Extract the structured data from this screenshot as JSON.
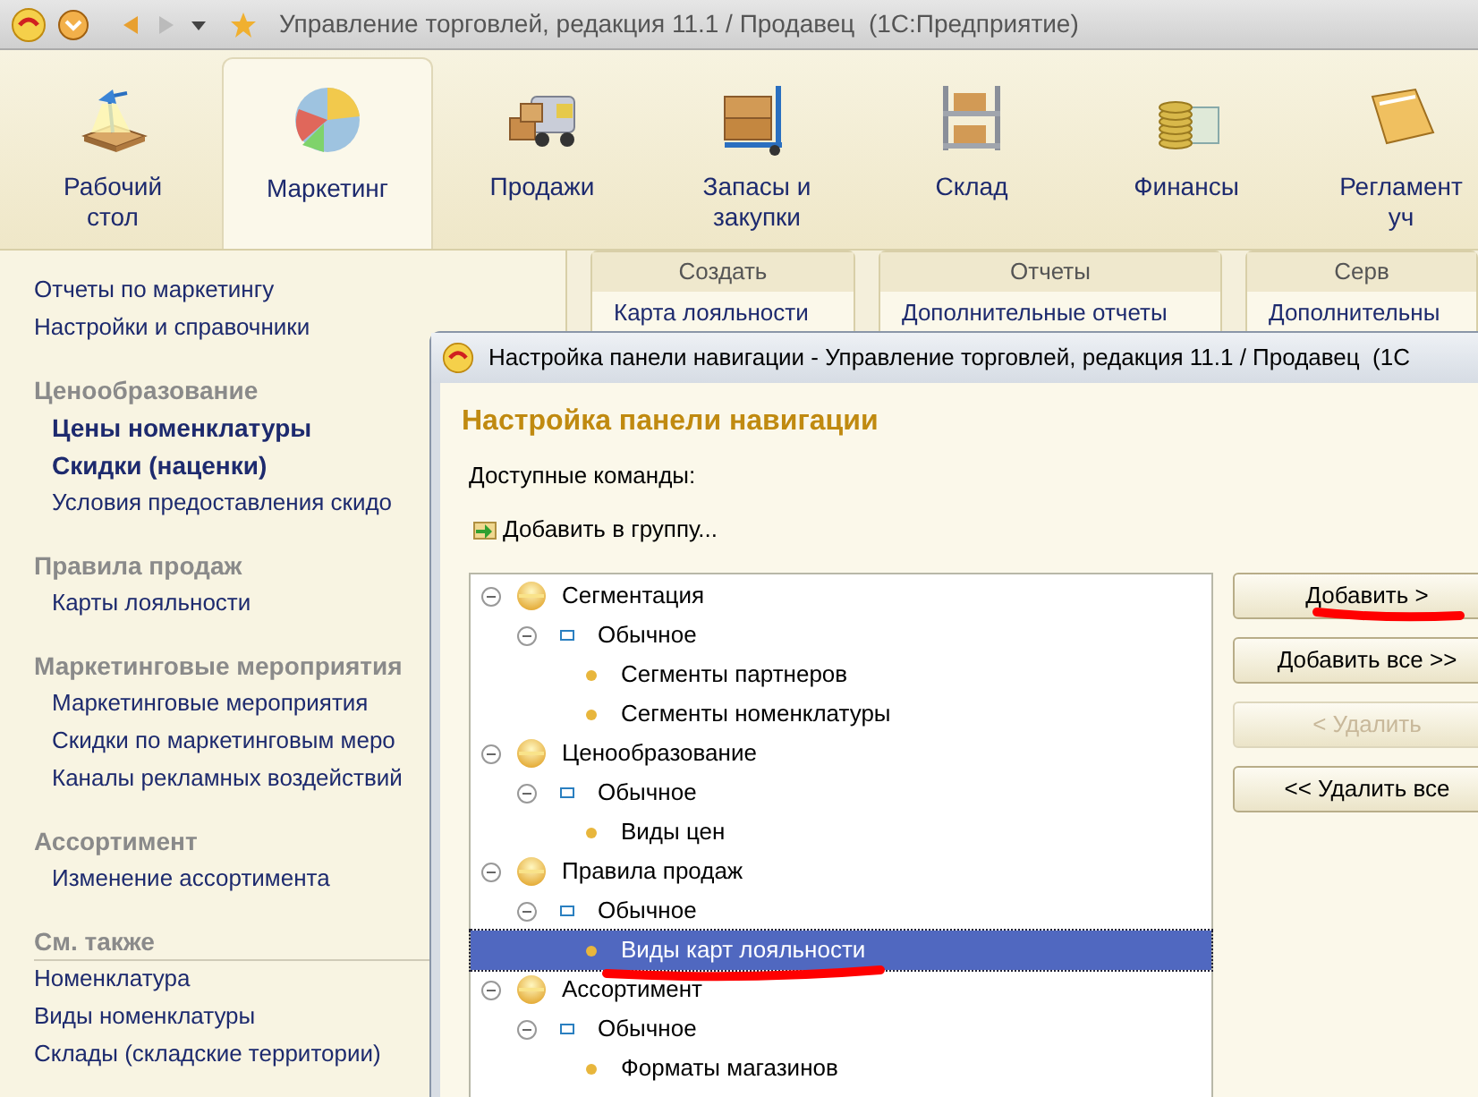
{
  "window": {
    "title": "Управление торговлей, редакция 11.1 / Продавец  (1С:Предприятие)"
  },
  "sections": [
    {
      "lines": [
        "Рабочий",
        "стол"
      ],
      "selected": false
    },
    {
      "lines": [
        "Маркетинг"
      ],
      "selected": true
    },
    {
      "lines": [
        "Продажи"
      ],
      "selected": false
    },
    {
      "lines": [
        "Запасы и",
        "закупки"
      ],
      "selected": false
    },
    {
      "lines": [
        "Склад"
      ],
      "selected": false
    },
    {
      "lines": [
        "Финансы"
      ],
      "selected": false
    },
    {
      "lines": [
        "Регламент",
        "уч"
      ],
      "selected": false
    }
  ],
  "sidebar": {
    "groups": [
      {
        "items": [
          {
            "label": "Отчеты по маркетингу",
            "emphasized": false
          },
          {
            "label": "Настройки и справочники",
            "emphasized": false
          }
        ]
      },
      {
        "title": "Ценообразование",
        "items": [
          {
            "label": "Цены номенклатуры",
            "emphasized": true
          },
          {
            "label": "Скидки (наценки)",
            "emphasized": true
          },
          {
            "label": "Условия предоставления скидо",
            "emphasized": false
          }
        ]
      },
      {
        "title": "Правила продаж",
        "items": [
          {
            "label": "Карты лояльности",
            "emphasized": false
          }
        ]
      },
      {
        "title": "Маркетинговые мероприятия",
        "items": [
          {
            "label": "Маркетинговые мероприятия",
            "emphasized": false
          },
          {
            "label": "Скидки по маркетинговым меро",
            "emphasized": false
          },
          {
            "label": "Каналы рекламных воздействий",
            "emphasized": false
          }
        ]
      },
      {
        "title": "Ассортимент",
        "items": [
          {
            "label": "Изменение ассортимента",
            "emphasized": false
          }
        ]
      },
      {
        "title": "См. также",
        "flat": true,
        "items": [
          {
            "label": "Номенклатура",
            "emphasized": false
          },
          {
            "label": "Виды номенклатуры",
            "emphasized": false
          },
          {
            "label": "Склады (складские территории)",
            "emphasized": false
          }
        ]
      }
    ]
  },
  "panels": [
    {
      "title": "Создать",
      "items": [
        "Карта лояльности"
      ]
    },
    {
      "title": "Отчеты",
      "items": [
        "Дополнительные отчеты"
      ]
    },
    {
      "title": "Серв",
      "items": [
        "Дополнительны"
      ]
    }
  ],
  "dialog": {
    "title": "Настройка панели навигации - Управление торговлей, редакция 11.1 / Продавец  (1С",
    "heading": "Настройка панели навигации",
    "label": "Доступные команды:",
    "add_to_group": "Добавить в группу...",
    "tree": [
      {
        "label": "Сегментация",
        "expanded": true,
        "selected": false,
        "children": [
          {
            "label": "Обычное",
            "expanded": true,
            "selected": false,
            "children": [
              {
                "label": "Сегменты партнеров",
                "selected": false
              },
              {
                "label": "Сегменты номенклатуры",
                "selected": false
              }
            ]
          }
        ]
      },
      {
        "label": "Ценообразование",
        "expanded": true,
        "selected": false,
        "children": [
          {
            "label": "Обычное",
            "expanded": true,
            "selected": false,
            "children": [
              {
                "label": "Виды цен",
                "selected": false
              }
            ]
          }
        ]
      },
      {
        "label": "Правила продаж",
        "expanded": true,
        "selected": false,
        "children": [
          {
            "label": "Обычное",
            "expanded": true,
            "selected": false,
            "children": [
              {
                "label": "Виды карт лояльности",
                "selected": true
              }
            ]
          }
        ]
      },
      {
        "label": "Ассортимент",
        "expanded": true,
        "selected": false,
        "children": [
          {
            "label": "Обычное",
            "expanded": true,
            "selected": false,
            "children": [
              {
                "label": "Форматы магазинов",
                "selected": false
              }
            ]
          }
        ]
      }
    ],
    "buttons": [
      {
        "label": "Добавить >",
        "disabled": false
      },
      {
        "label": "Добавить все >>",
        "disabled": false
      },
      {
        "label": "< Удалить",
        "disabled": true
      },
      {
        "label": "<< Удалить все",
        "disabled": false
      }
    ]
  }
}
